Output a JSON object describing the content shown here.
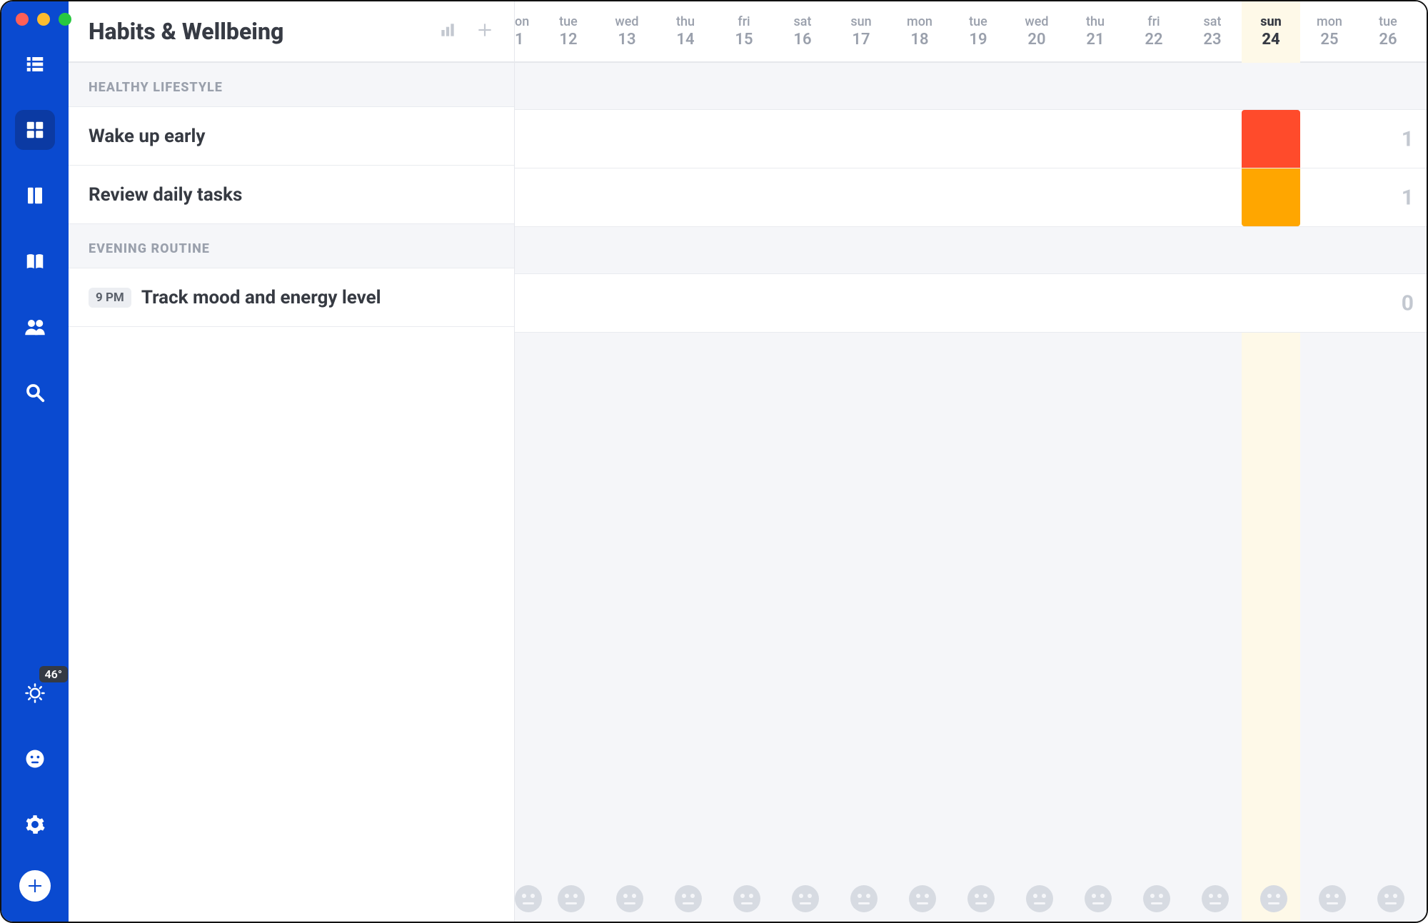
{
  "page_title": "Habits & Wellbeing",
  "weather_badge": "46°",
  "calendar_days": [
    {
      "name": "on",
      "num": "1",
      "partial": true
    },
    {
      "name": "tue",
      "num": "12"
    },
    {
      "name": "wed",
      "num": "13"
    },
    {
      "name": "thu",
      "num": "14"
    },
    {
      "name": "fri",
      "num": "15"
    },
    {
      "name": "sat",
      "num": "16"
    },
    {
      "name": "sun",
      "num": "17"
    },
    {
      "name": "mon",
      "num": "18"
    },
    {
      "name": "tue",
      "num": "19"
    },
    {
      "name": "wed",
      "num": "20"
    },
    {
      "name": "thu",
      "num": "21"
    },
    {
      "name": "fri",
      "num": "22"
    },
    {
      "name": "sat",
      "num": "23"
    },
    {
      "name": "sun",
      "num": "24",
      "today": true
    },
    {
      "name": "mon",
      "num": "25"
    },
    {
      "name": "tue",
      "num": "26"
    }
  ],
  "today_index": 13,
  "sections": [
    {
      "title": "HEALTHY LIFESTYLE",
      "habits": [
        {
          "title": "Wake up early",
          "time": null,
          "streak": "1",
          "today_color": "red"
        },
        {
          "title": "Review daily tasks",
          "time": null,
          "streak": "1",
          "today_color": "orange"
        }
      ]
    },
    {
      "title": "EVENING ROUTINE",
      "habits": [
        {
          "title": "Track mood and energy level",
          "time": "9 PM",
          "streak": "0",
          "today_color": null
        }
      ]
    }
  ]
}
